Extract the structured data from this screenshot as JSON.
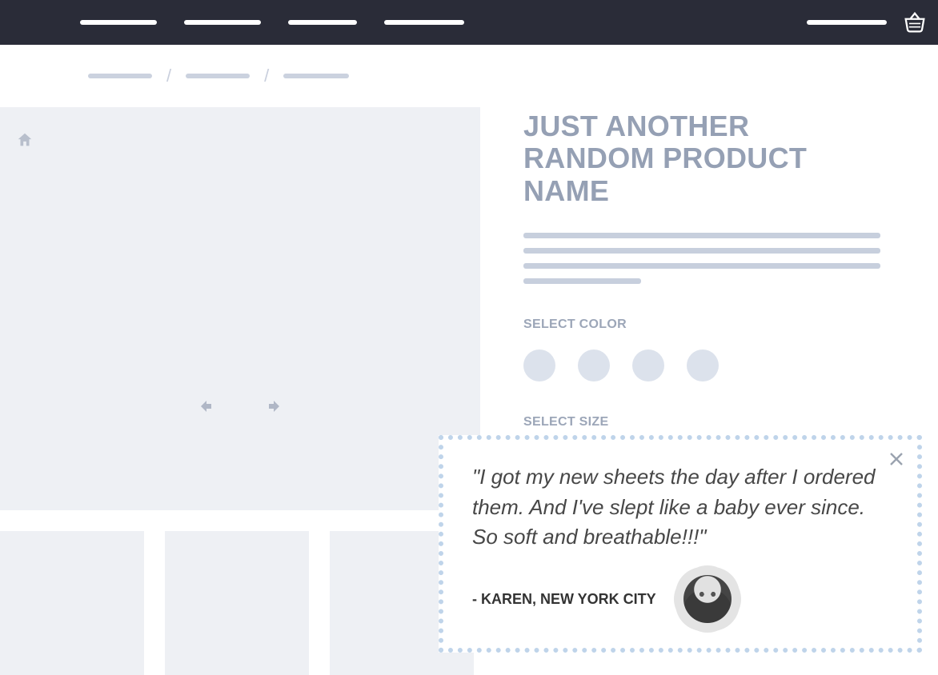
{
  "header": {
    "nav_items": [
      "nav1",
      "nav2",
      "nav3",
      "nav4"
    ],
    "right_item": "account",
    "cart_icon": "basket-icon"
  },
  "breadcrumb": {
    "items": [
      "level1",
      "level2",
      "level3"
    ],
    "separator": "/"
  },
  "gallery": {
    "home_icon": "home-icon",
    "prev_icon": "arrow-left-icon",
    "next_icon": "arrow-right-icon",
    "thumbnails": [
      "thumb-1",
      "thumb-2",
      "thumb-3"
    ]
  },
  "product": {
    "title": "JUST ANOTHER RANDOM PRODUCT NAME",
    "color_label": "SELECT COLOR",
    "colors": [
      "color-1",
      "color-2",
      "color-3",
      "color-4"
    ],
    "size_label": "SELECT SIZE",
    "size_dropdown_icon": "chevron-down-icon",
    "cta_label": "add-to-cart"
  },
  "popup": {
    "close_icon": "close-icon",
    "quote": "\"I got my new sheets the day after I ordered them. And I've slept like a baby ever since. So soft and breathable!!!\"",
    "attribution": "- KAREN, NEW YORK CITY",
    "avatar": "reviewer-avatar"
  },
  "colors": {
    "header_bg": "#2A2C38",
    "placeholder": "#C7CFDD",
    "panel": "#EEF0F4",
    "title": "#95A0B4",
    "swatch": "#DCE2EC",
    "cta": "#B7C2D6",
    "popup_border": "#BFD4EA"
  }
}
